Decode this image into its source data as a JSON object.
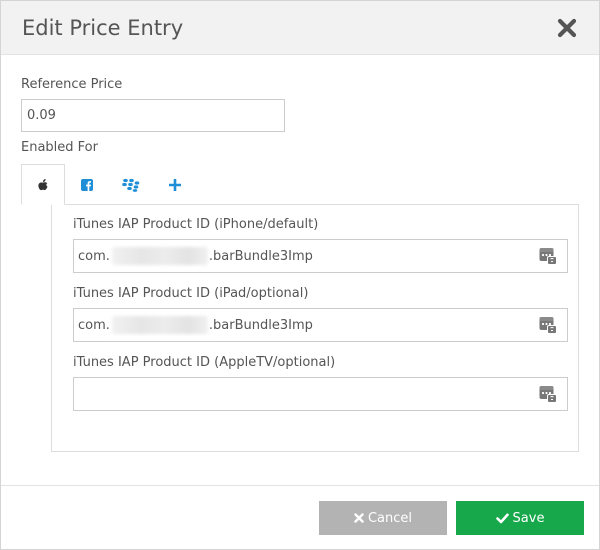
{
  "modal": {
    "title": "Edit Price Entry",
    "close_icon": "close-icon"
  },
  "reference_price": {
    "label": "Reference Price",
    "value": "0.09"
  },
  "enabled_for": {
    "label": "Enabled For",
    "tabs": [
      {
        "icon": "apple-icon",
        "active": true
      },
      {
        "icon": "facebook-icon",
        "active": false
      },
      {
        "icon": "blackberry-icon",
        "active": false
      },
      {
        "icon": "plus-icon",
        "active": false
      }
    ]
  },
  "product_ids": [
    {
      "label": "iTunes IAP Product ID (iPhone/default)",
      "prefix": "com.",
      "suffix": ".barBundle3Imp"
    },
    {
      "label": "iTunes IAP Product ID (iPad/optional)",
      "prefix": "com.",
      "suffix": ".barBundle3Imp"
    },
    {
      "label": "iTunes IAP Product ID (AppleTV/optional)",
      "prefix": "",
      "suffix": ""
    }
  ],
  "footer": {
    "cancel_label": "Cancel",
    "save_label": "Save"
  },
  "colors": {
    "save": "#17a84b",
    "cancel": "#b3b3b3",
    "tab_icon_active": "#333333",
    "tab_icon": "#1e8fd6"
  }
}
